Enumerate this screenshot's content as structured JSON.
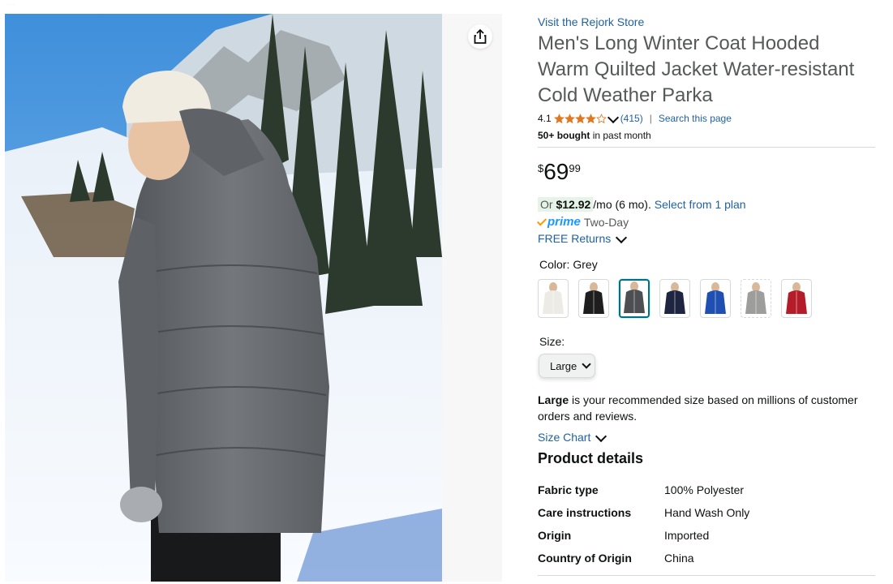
{
  "product": {
    "store_link": "Visit the Rejork Store",
    "title": "Men's Long Winter Coat Hooded Warm Quilted Jacket Water-resistant Cold Weather Parka",
    "rating_value": "4.1",
    "rating_stars": 4.1,
    "rating_count": "(415)",
    "separator": "|",
    "search_link": "Search this page",
    "bought_bold": "50+ bought",
    "bought_rest": "in past month"
  },
  "price": {
    "symbol": "$",
    "whole": "69",
    "fraction": "99"
  },
  "installment": {
    "prefix": "Or",
    "amount": "$12.92",
    "term": "/mo (6 mo).",
    "plan_link": "Select from 1 plan"
  },
  "delivery": {
    "prime": "prime",
    "speed": "Two-Day",
    "returns": "FREE Returns"
  },
  "color": {
    "label": "Color:",
    "selected": "Grey",
    "swatches": [
      {
        "name": "White",
        "hex": "#ecebe6",
        "selected": false
      },
      {
        "name": "Black",
        "hex": "#1e1e1e",
        "selected": false
      },
      {
        "name": "Grey",
        "hex": "#4d4f52",
        "selected": true
      },
      {
        "name": "Navy",
        "hex": "#1d2540",
        "selected": false
      },
      {
        "name": "Blue",
        "hex": "#1f4fb0",
        "selected": false
      },
      {
        "name": "Light Grey",
        "hex": "#9d9d9b",
        "selected": false
      },
      {
        "name": "Red",
        "hex": "#b51c2a",
        "selected": false
      }
    ]
  },
  "size": {
    "label": "Size:",
    "selected": "Large",
    "recommend_bold": "Large",
    "recommend_rest": "is your recommended size based on millions of customer orders and reviews.",
    "chart_link": "Size Chart"
  },
  "product_details": {
    "title": "Product details",
    "rows": [
      {
        "key": "Fabric type",
        "value": "100% Polyester"
      },
      {
        "key": "Care instructions",
        "value": "Hand Wash Only"
      },
      {
        "key": "Origin",
        "value": "Imported"
      },
      {
        "key": "Country of Origin",
        "value": "China"
      }
    ]
  },
  "icons": {
    "share": "share-icon",
    "star": "star-icon",
    "chevron": "chevron-down-icon",
    "check": "check-icon"
  },
  "colors": {
    "link": "#2162a1",
    "star": "#de7921",
    "prime": "#1a98ff",
    "selected_border": "#007185"
  }
}
